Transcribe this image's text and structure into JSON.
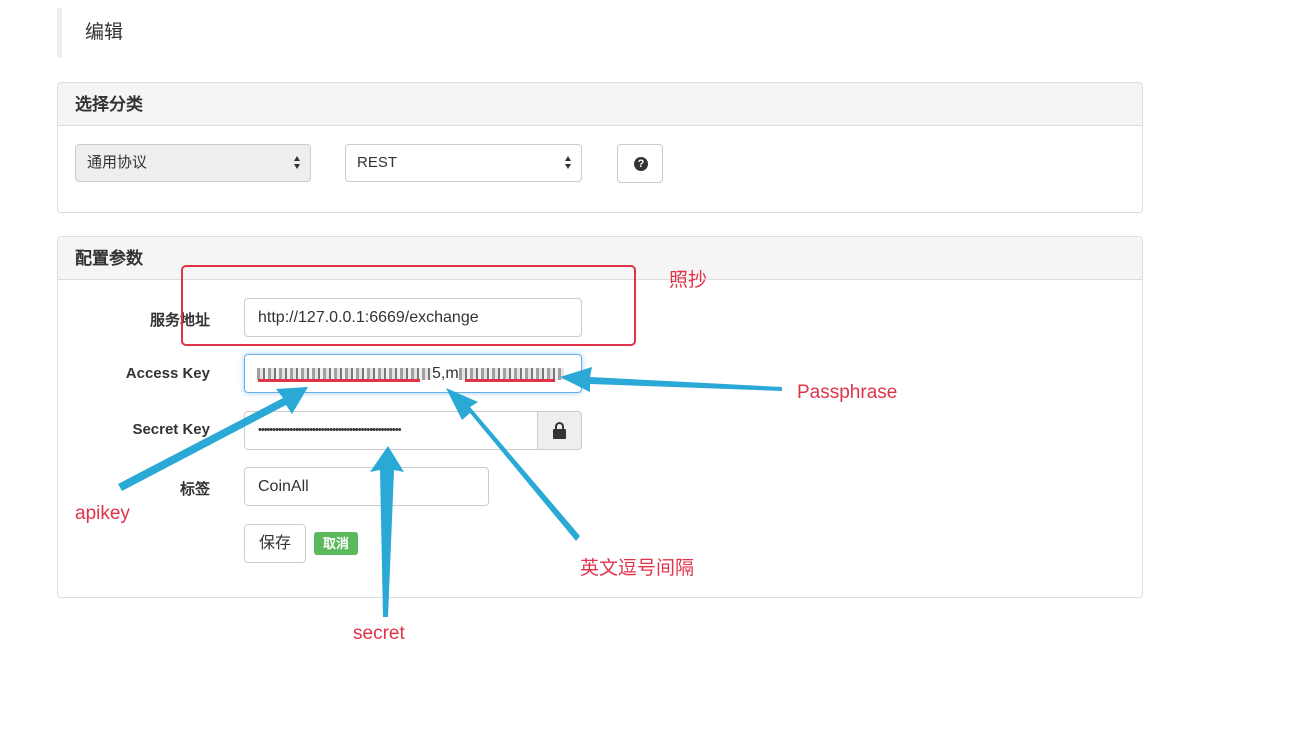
{
  "page": {
    "title": "编辑"
  },
  "category_panel": {
    "heading": "选择分类",
    "protocol_select": "通用协议",
    "type_select": "REST",
    "help_icon": "question-circle"
  },
  "config_panel": {
    "heading": "配置参数",
    "service_address_label": "服务地址",
    "service_address_value": "http://127.0.0.1:6669/exchange",
    "access_key_label": "Access Key",
    "access_key_visible_fragment": "5,m",
    "secret_key_label": "Secret Key",
    "secret_key_value": "••••••••••••••••••••••••••••••••••••••••••••••••••",
    "lock_icon": "lock",
    "tag_label": "标签",
    "tag_value": "CoinAll",
    "save_button": "保存",
    "cancel_badge": "取消"
  },
  "annotations": {
    "copy_note": "照抄",
    "passphrase": "Passphrase",
    "apikey": "apikey",
    "comma_note": "英文逗号间隔",
    "secret": "secret"
  },
  "colors": {
    "annotation_red": "#e0334a",
    "arrow_blue": "#2aa9d6",
    "success_green": "#5cb85c"
  }
}
